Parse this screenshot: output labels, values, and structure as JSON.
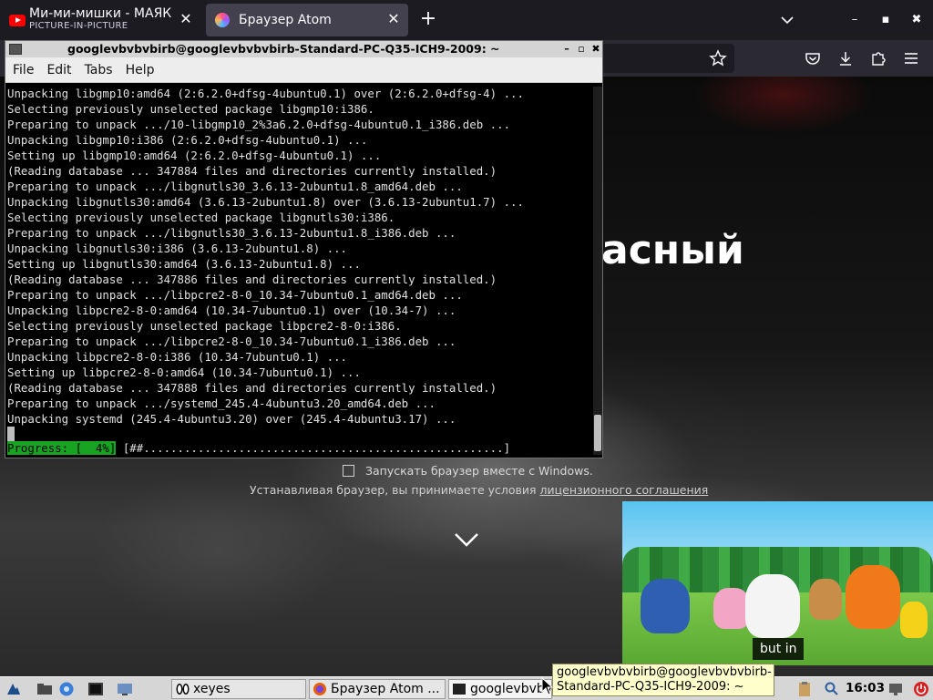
{
  "browser": {
    "tabs": [
      {
        "title": "Ми-ми-мишки - МАЯК - …",
        "subtitle": "PICTURE-IN-PICTURE"
      },
      {
        "title": "Браузер Atom"
      }
    ],
    "new_tab": "+",
    "window_controls": {
      "minimize": "–",
      "maximize": "▪",
      "close": "✖"
    }
  },
  "page": {
    "headline": "асный",
    "autostart_label": "Запускать браузер вместе с Windows.",
    "terms_prefix": "Устанавливая браузер, вы принимаете условия ",
    "terms_link": "лицензионного соглашения"
  },
  "pip": {
    "caption": "but in"
  },
  "terminal": {
    "title": "googlevbvbvbirb@googlevbvbvbirb-Standard-PC-Q35-ICH9-2009: ~",
    "menu": [
      "File",
      "Edit",
      "Tabs",
      "Help"
    ],
    "lines": [
      "Unpacking libgmp10:amd64 (2:6.2.0+dfsg-4ubuntu0.1) over (2:6.2.0+dfsg-4) ...",
      "Selecting previously unselected package libgmp10:i386.",
      "Preparing to unpack .../10-libgmp10_2%3a6.2.0+dfsg-4ubuntu0.1_i386.deb ...",
      "Unpacking libgmp10:i386 (2:6.2.0+dfsg-4ubuntu0.1) ...",
      "Setting up libgmp10:amd64 (2:6.2.0+dfsg-4ubuntu0.1) ...",
      "(Reading database ... 347884 files and directories currently installed.)",
      "Preparing to unpack .../libgnutls30_3.6.13-2ubuntu1.8_amd64.deb ...",
      "Unpacking libgnutls30:amd64 (3.6.13-2ubuntu1.8) over (3.6.13-2ubuntu1.7) ...",
      "Selecting previously unselected package libgnutls30:i386.",
      "Preparing to unpack .../libgnutls30_3.6.13-2ubuntu1.8_i386.deb ...",
      "Unpacking libgnutls30:i386 (3.6.13-2ubuntu1.8) ...",
      "Setting up libgnutls30:amd64 (3.6.13-2ubuntu1.8) ...",
      "(Reading database ... 347886 files and directories currently installed.)",
      "Preparing to unpack .../libpcre2-8-0_10.34-7ubuntu0.1_amd64.deb ...",
      "Unpacking libpcre2-8-0:amd64 (10.34-7ubuntu0.1) over (10.34-7) ...",
      "Selecting previously unselected package libpcre2-8-0:i386.",
      "Preparing to unpack .../libpcre2-8-0_10.34-7ubuntu0.1_i386.deb ...",
      "Unpacking libpcre2-8-0:i386 (10.34-7ubuntu0.1) ...",
      "Setting up libpcre2-8-0:amd64 (10.34-7ubuntu0.1) ...",
      "(Reading database ... 347888 files and directories currently installed.)",
      "Preparing to unpack .../systemd_245.4-4ubuntu3.20_amd64.deb ...",
      "Unpacking systemd (245.4-4ubuntu3.20) over (245.4-4ubuntu3.17) ..."
    ],
    "progress_label": "Progress: [  4%]",
    "progress_bar": " [##.....................................................]"
  },
  "taskbar": {
    "tasks": [
      {
        "label": "xeyes"
      },
      {
        "label": "Браузер Atom ..."
      },
      {
        "label": "googlevbvbv..."
      }
    ],
    "clock": "16:03"
  },
  "tooltip": {
    "text": "googlevbvbvbirb@googlevbvbvbirb-Standard-PC-Q35-ICH9-2009: ~"
  }
}
